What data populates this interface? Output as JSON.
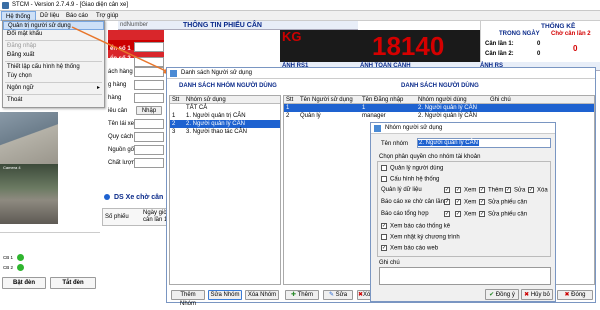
{
  "app": {
    "title": "STCM - Version 2.7.4.9 - [Giao diện cân xe]"
  },
  "menubar": [
    "Hệ thống",
    "Dữ liệu",
    "Báo cáo",
    "Trợ giúp"
  ],
  "system_menu": {
    "items": [
      {
        "label": "Quản trị người sử dụng",
        "state": "active"
      },
      {
        "label": "Đổi mật khẩu",
        "state": "normal"
      },
      {
        "label": "Đăng nhập",
        "state": "disabled"
      },
      {
        "label": "Đăng xuất",
        "state": "normal"
      },
      {
        "label": "Thiết lập cấu hình hệ thống",
        "state": "normal"
      },
      {
        "label": "Tùy chọn",
        "state": "normal"
      },
      {
        "label": "Ngôn ngữ",
        "state": "normal",
        "submenu": "▸"
      },
      {
        "label": "Thoát",
        "state": "normal"
      }
    ]
  },
  "weigh": {
    "header": "THÔNG TIN PHIẾU CÂN",
    "unit": "KG",
    "value": "18140",
    "stats_header": "THỐNG KÊ",
    "trong_ngay": "TRONG NGÀY",
    "cho_can_lan2": "Chờ cân lần 2",
    "can_lan1": "Cân lần 1:",
    "can_lan2": "Cân lần 2:",
    "v1": "0",
    "v2": "0",
    "v_wait": "0",
    "anh_rs1": "ẢNH RS1",
    "anh_toan_canh": "ẢNH TOÀN CẢNH",
    "anh_rs": "ẢNH RS",
    "mini_header": "ndNumber"
  },
  "left_fields": [
    "Phiếu cân",
    "Biển số 1",
    "Biển số 2",
    "Khách hàng",
    "Hàng",
    "Mã hàng",
    "Tên lái xe",
    "Quy cách",
    "Nguồn gốc",
    "Chất lượng"
  ],
  "left_fields_vis": [
    "ách hàng",
    "g hàng",
    "hàng",
    "iêu cân",
    "Tên lái xe",
    "Quy cách",
    "Nguồn gốc",
    "Chất lượng"
  ],
  "nhap_label": "Nhập",
  "ds_xe": "DS Xe chờ cân",
  "list_cols": [
    "Số phiếu",
    "Ngày giờ cân lần 1"
  ],
  "cb1": "CB 1",
  "cb2": "CB 2",
  "bat_den": "Bật đèn",
  "tat_den": "Tắt đèn",
  "cam_title": "Camera 4",
  "user_win": {
    "title": "Danh sách Người sử dụng",
    "groups_header": "DANH SÁCH NHÓM NGƯỜI DÙNG",
    "users_header": "DANH SÁCH NGƯỜI DÙNG",
    "group_cols": [
      "Stt",
      "Nhóm sử dụng"
    ],
    "groups": [
      {
        "stt": "",
        "name": "TẤT CẢ"
      },
      {
        "stt": "1",
        "name": "1. Người quản trị CÂN"
      },
      {
        "stt": "2",
        "name": "2. Người quản lý CÂN"
      },
      {
        "stt": "3",
        "name": "3. Người thao tác CÂN"
      }
    ],
    "user_cols": [
      "Stt",
      "Tên Người sử dụng",
      "Tên Đăng nhập",
      "Nhóm người dùng",
      "Ghi chú"
    ],
    "users": [
      {
        "stt": "1",
        "name": "",
        "login": "1",
        "group": "2. Người quản lý CÂN"
      },
      {
        "stt": "2",
        "name": "Quản lý",
        "login": "manager",
        "group": "2. Người quản lý CÂN"
      }
    ],
    "btn_them_nhom": "Thêm Nhóm",
    "btn_sua_nhom": "Sửa Nhóm",
    "btn_xoa_nhom": "Xóa Nhóm",
    "btn_them": "Thêm",
    "btn_sua": "Sửa",
    "btn_xoa": "Xóa",
    "btn_dong": "Đóng"
  },
  "group_dlg": {
    "title": "Nhóm người sử dụng",
    "name_label": "Tên nhóm",
    "name_value": "2. Người quản lý CÂN",
    "perm_label": "Chọn phân quyền cho nhóm tài khoản",
    "perms": [
      {
        "label": "Quản lý người dùng",
        "checked": false,
        "sub": []
      },
      {
        "label": "Cấu hình hệ thống",
        "checked": false,
        "sub": []
      },
      {
        "label": "Quản lý dữ liệu",
        "checked": true,
        "sub": [
          {
            "label": "Xem",
            "checked": true
          },
          {
            "label": "Thêm",
            "checked": true
          },
          {
            "label": "Sửa",
            "checked": true
          },
          {
            "label": "Xóa",
            "checked": true
          }
        ]
      },
      {
        "label": "Báo cáo xe chờ cân lần 2",
        "checked": true,
        "sub": [
          {
            "label": "Xem",
            "checked": true
          },
          {
            "label": "Sửa phiếu cân",
            "checked": true
          }
        ]
      },
      {
        "label": "Báo cáo tổng hợp",
        "checked": true,
        "sub": [
          {
            "label": "Xem",
            "checked": true
          },
          {
            "label": "Sửa phiếu cân",
            "checked": true
          }
        ]
      },
      {
        "label": "Xem báo cáo thống kê",
        "checked": true,
        "sub": []
      },
      {
        "label": "Xem nhật ký chương trình",
        "checked": false,
        "sub": []
      },
      {
        "label": "Xem báo cáo web",
        "checked": true,
        "sub": []
      }
    ],
    "note_label": "Ghi chú",
    "ok": "Đồng ý",
    "cancel": "Hủy bỏ"
  },
  "colors": {
    "accent": "#1e62d0",
    "red": "#d40000",
    "dark": "#1a1a1a"
  }
}
